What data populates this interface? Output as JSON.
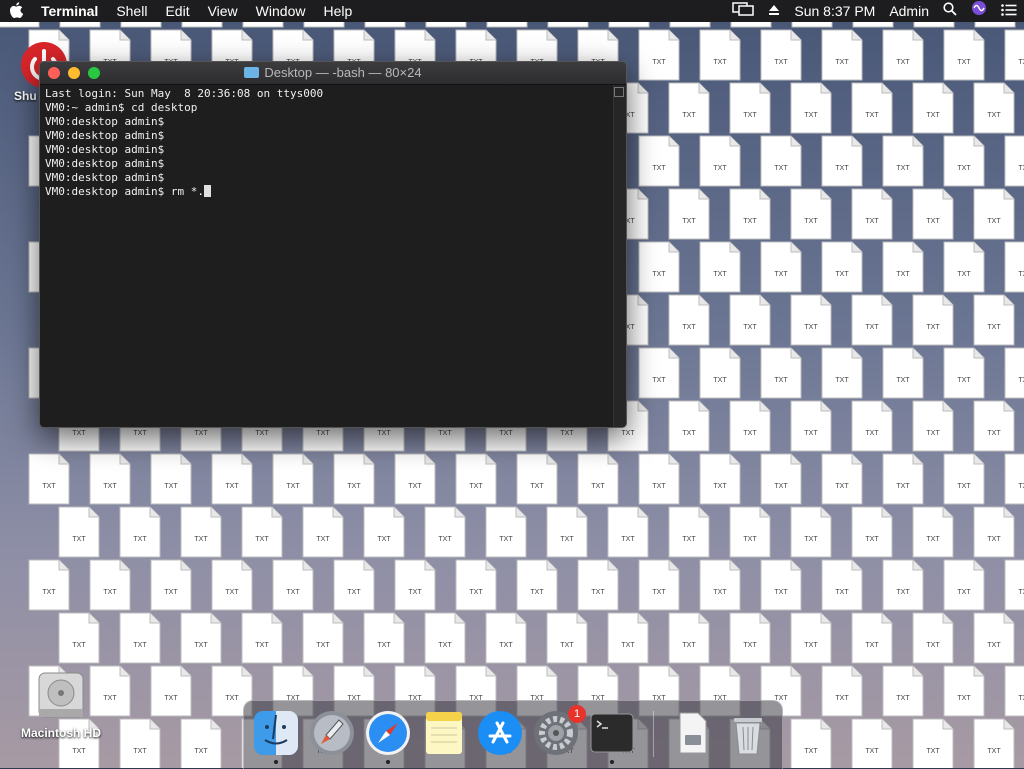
{
  "menubar": {
    "app_name": "Terminal",
    "menus": [
      "Shell",
      "Edit",
      "View",
      "Window",
      "Help"
    ],
    "clock": "Sun 8:37 PM",
    "user": "Admin"
  },
  "desktop": {
    "disk_label": "Macintosh HD",
    "partial_label_left": "Shu",
    "file_badge": "TXT"
  },
  "terminal": {
    "title": "Desktop — -bash — 80×24",
    "lines": [
      "Last login: Sun May  8 20:36:08 on ttys000",
      "VM0:~ admin$ cd desktop",
      "VM0:desktop admin$",
      "VM0:desktop admin$",
      "VM0:desktop admin$",
      "VM0:desktop admin$",
      "VM0:desktop admin$",
      "VM0:desktop admin$ rm *."
    ]
  },
  "dock": {
    "items": [
      {
        "name": "Finder",
        "icon": "finder-icon"
      },
      {
        "name": "Launchpad",
        "icon": "rocket-icon"
      },
      {
        "name": "Safari",
        "icon": "compass-icon"
      },
      {
        "name": "Notes",
        "icon": "notes-icon"
      },
      {
        "name": "App Store",
        "icon": "app-store-icon"
      },
      {
        "name": "System Preferences",
        "icon": "gear-icon",
        "badge": "1"
      },
      {
        "name": "Terminal",
        "icon": "terminal-icon"
      },
      {
        "name": "Downloads",
        "icon": "document-icon"
      },
      {
        "name": "Trash",
        "icon": "trash-icon"
      }
    ]
  }
}
